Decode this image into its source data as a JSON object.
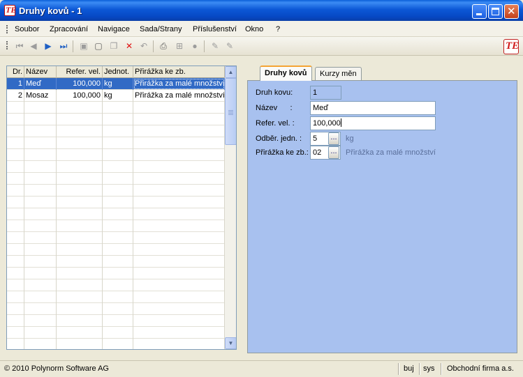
{
  "window": {
    "title": "Druhy kovů - 1"
  },
  "menu": [
    "Soubor",
    "Zpracování",
    "Navigace",
    "Sada/Strany",
    "Příslušenství",
    "Okno",
    "?"
  ],
  "toolbar": {
    "icons": [
      "first-record-icon",
      "previous-record-icon",
      "next-record-icon",
      "last-record-icon",
      "save-icon",
      "new-record-icon",
      "copy-icon",
      "delete-icon",
      "undo-icon",
      "print-icon",
      "tree-icon",
      "filter-icon",
      "edit-icon",
      "edit-disabled-icon"
    ],
    "logo_text": "TE"
  },
  "grid": {
    "columns": [
      "Dr.",
      "Název",
      "Refer. vel.",
      "Jednot.",
      "Přirážka ke zb."
    ],
    "rows": [
      {
        "dr": "1",
        "nazev": "Meď",
        "refer": "100,000",
        "jednot": "kg",
        "prirazka": "Přirážka za malé množství"
      },
      {
        "dr": "2",
        "nazev": "Mosaz",
        "refer": "100,000",
        "jednot": "kg",
        "prirazka": "Přirážka za malé množství"
      }
    ],
    "selected_row": 0
  },
  "tabs": [
    {
      "label": "Druhy kovů",
      "active": true
    },
    {
      "label": "Kurzy měn",
      "active": false
    }
  ],
  "form": {
    "druh_label": "Druh kovu:",
    "druh_value": "1",
    "nazev_label": "Název      :",
    "nazev_value": "Meď",
    "refer_label": "Refer. vel. :",
    "refer_value": "100,000",
    "odber_label": "Odběr. jedn. :",
    "odber_value": "5",
    "odber_unit": "kg",
    "prirazka_label": "Přirážka ke zb.:",
    "prirazka_value": "02",
    "prirazka_desc": "Přirážka za malé množství",
    "ellipsis": "..."
  },
  "status": {
    "copyright": "© 2010 Polynorm Software AG",
    "user": "buj",
    "db": "sys",
    "company": "Obchodní firma a.s."
  }
}
